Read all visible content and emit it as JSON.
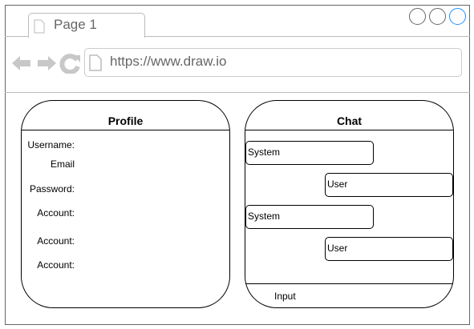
{
  "browser": {
    "tab_label": "Page 1",
    "url": "https://www.draw.io",
    "window_controls": [
      "minimize",
      "maximize",
      "close"
    ],
    "close_color": "#1e90ff"
  },
  "profile": {
    "title": "Profile",
    "fields": [
      "Username:",
      "Email",
      "Password:",
      "Account:",
      "Account:",
      "Account:"
    ]
  },
  "chat": {
    "title": "Chat",
    "messages": [
      {
        "sender": "System"
      },
      {
        "sender": "User"
      },
      {
        "sender": "System"
      },
      {
        "sender": "User"
      }
    ],
    "input_label": "Input"
  }
}
